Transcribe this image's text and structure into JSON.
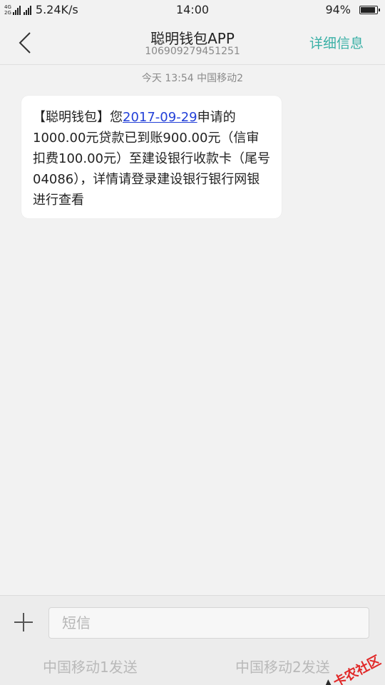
{
  "status_bar": {
    "net_tag_1": "4G",
    "net_tag_2": "2G",
    "speed": "5.24K/s",
    "time": "14:00",
    "battery_text": "94%",
    "battery_level": 0.94
  },
  "header": {
    "title": "聪明钱包APP",
    "number": "106909279451251",
    "detail_label": "详细信息"
  },
  "thread": {
    "timestamp": "今天  13:54  中国移动2",
    "message": {
      "before_link": "【聪明钱包】您",
      "link_text": "2017-09-29",
      "after_link": "申请的1000.00元贷款已到账900.00元（信审扣费100.00元）至建设银行收款卡（尾号04086），详情请登录建设银行银行网银进行查看"
    }
  },
  "composer": {
    "placeholder": "短信",
    "send_sim1": "中国移动1发送",
    "send_sim2": "中国移动2发送"
  },
  "watermark": {
    "text": "卡农社区"
  },
  "colors": {
    "accent": "#3ab0a6",
    "link": "#2340d8",
    "watermark": "#e12828"
  }
}
